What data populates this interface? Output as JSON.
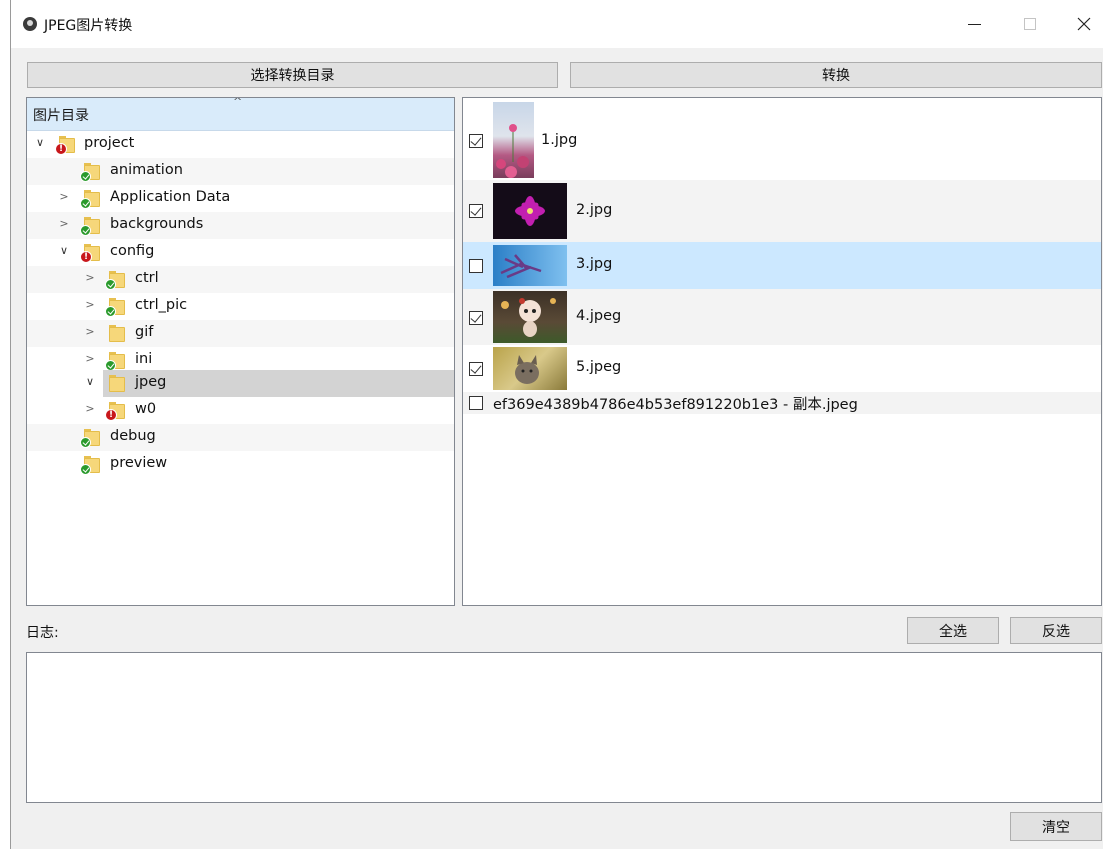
{
  "window": {
    "title": "JPEG图片转换",
    "controls": [
      "minimize",
      "maximize",
      "close"
    ]
  },
  "toolbar": {
    "select_dir_label": "选择转换目录",
    "convert_label": "转换"
  },
  "tree": {
    "header": "图片目录",
    "rows": [
      {
        "label": "project",
        "status": "warning",
        "expanded": true
      },
      {
        "label": "animation",
        "status": "ok"
      },
      {
        "label": "Application Data",
        "status": "ok",
        "expandable": true
      },
      {
        "label": "backgrounds",
        "status": "ok",
        "expandable": true
      },
      {
        "label": "config",
        "status": "warning",
        "expanded": true
      },
      {
        "label": "ctrl",
        "status": "ok",
        "expandable": true
      },
      {
        "label": "ctrl_pic",
        "status": "ok",
        "expandable": true
      },
      {
        "label": "gif",
        "status": "none",
        "expandable": true
      },
      {
        "label": "ini",
        "status": "ok",
        "expandable": true
      },
      {
        "label": "jpeg",
        "status": "none",
        "expanded": true,
        "selected": true
      },
      {
        "label": "w0",
        "status": "warning",
        "expandable": true
      },
      {
        "label": "debug",
        "status": "ok"
      },
      {
        "label": "preview",
        "status": "ok"
      }
    ]
  },
  "images": {
    "items": [
      {
        "name": "1.jpg",
        "checked": true
      },
      {
        "name": "2.jpg",
        "checked": true
      },
      {
        "name": "3.jpg",
        "checked": false,
        "selected": true
      },
      {
        "name": "4.jpeg",
        "checked": true
      },
      {
        "name": "5.jpeg",
        "checked": true
      },
      {
        "name": "ef369e4389b4786e4b53ef891220b1e3 - 副本.jpeg",
        "checked": false
      }
    ]
  },
  "actions": {
    "select_all_label": "全选",
    "invert_label": "反选",
    "clear_label": "清空"
  },
  "log": {
    "label": "日志:",
    "content": ""
  },
  "colors": {
    "tree_header": "#d9ebfa",
    "selection": "#cce8ff",
    "tree_selection": "#d3d3d3",
    "ok_badge": "#2a9a2c",
    "warning_badge": "#c8171b",
    "folder": "#f6d77a"
  }
}
